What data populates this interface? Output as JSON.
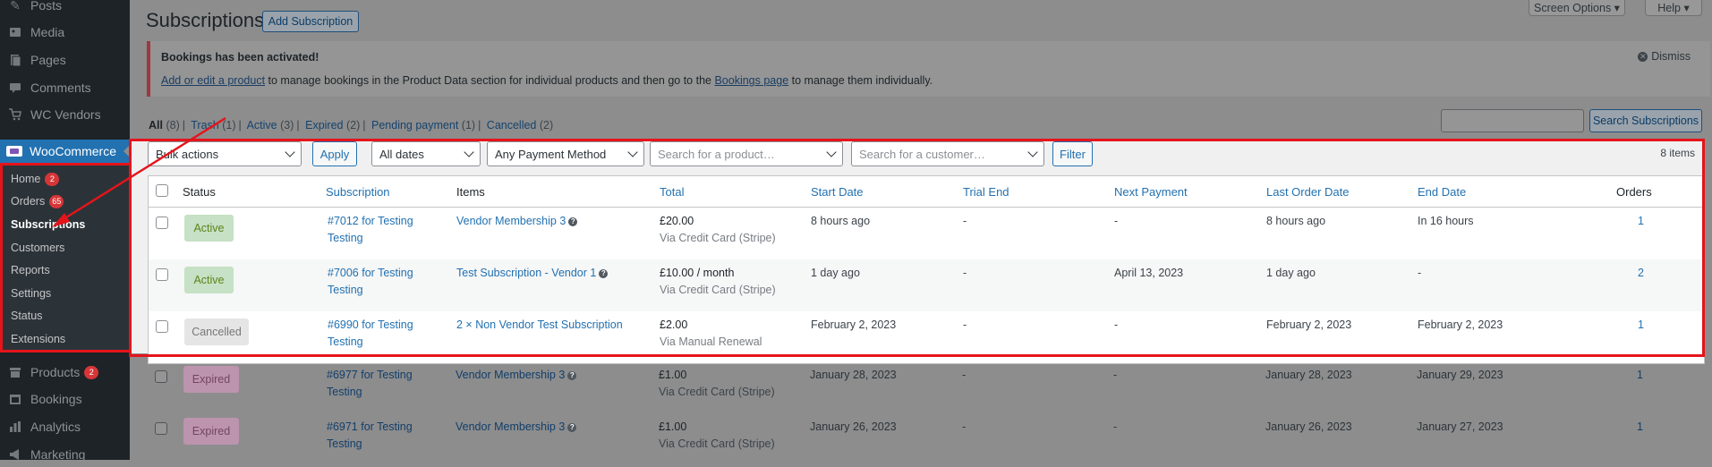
{
  "sidebar": {
    "items_top": [
      {
        "label": "Posts",
        "icon": "pin-icon"
      },
      {
        "label": "Media",
        "icon": "media-icon"
      },
      {
        "label": "Pages",
        "icon": "pages-icon"
      },
      {
        "label": "Comments",
        "icon": "comment-icon"
      },
      {
        "label": "WC Vendors",
        "icon": "cart-icon"
      }
    ],
    "woocommerce": {
      "label": "WooCommerce",
      "icon": "woocommerce-icon"
    },
    "submenu": [
      {
        "label": "Home",
        "badge": "2"
      },
      {
        "label": "Orders",
        "badge": "65"
      },
      {
        "label": "Subscriptions"
      },
      {
        "label": "Customers"
      },
      {
        "label": "Reports"
      },
      {
        "label": "Settings"
      },
      {
        "label": "Status"
      },
      {
        "label": "Extensions"
      }
    ],
    "items_bottom": [
      {
        "label": "Products",
        "badge": "2",
        "icon": "archive-icon"
      },
      {
        "label": "Bookings",
        "icon": "calendar-icon"
      },
      {
        "label": "Analytics",
        "icon": "bar-chart-icon"
      },
      {
        "label": "Marketing",
        "icon": "megaphone-icon"
      }
    ]
  },
  "header": {
    "title": "Subscriptions",
    "add_button": "Add Subscription",
    "screen_options": "Screen Options ▾",
    "help": "Help ▾"
  },
  "notice": {
    "title": "Bookings has been activated!",
    "link1": "Add or edit a product",
    "text1": " to manage bookings in the Product Data section for individual products and then go to the ",
    "link2": "Bookings page",
    "text2": " to manage them individually.",
    "dismiss": "Dismiss"
  },
  "filters": [
    {
      "label": "All",
      "count": "(8)"
    },
    {
      "label": "Trash",
      "count": "(1)"
    },
    {
      "label": "Active",
      "count": "(3)"
    },
    {
      "label": "Expired",
      "count": "(2)"
    },
    {
      "label": "Pending payment",
      "count": "(1)"
    },
    {
      "label": "Cancelled",
      "count": "(2)"
    }
  ],
  "search_button": "Search Subscriptions",
  "toolbar": {
    "bulk_actions": "Bulk actions",
    "apply": "Apply",
    "dates": "All dates",
    "payment_method": "Any Payment Method",
    "product_placeholder": "Search for a product…",
    "customer_placeholder": "Search for a customer…",
    "filter": "Filter",
    "items_count": "8 items"
  },
  "table": {
    "headers": [
      "Status",
      "Subscription",
      "Items",
      "Total",
      "Start Date",
      "Trial End",
      "Next Payment",
      "Last Order Date",
      "End Date",
      "Orders"
    ],
    "rows": [
      {
        "status": "Active",
        "sub_id": "#7012",
        "for": "for",
        "customer_l1": "Testing",
        "customer_l2": "Testing",
        "item": "Vendor Membership 3",
        "total": "£20.00",
        "via": "Via Credit Card (Stripe)",
        "start": "8 hours ago",
        "trial_end": "-",
        "next_payment": "-",
        "last_order": "8 hours ago",
        "end": "In 16 hours",
        "orders": "1"
      },
      {
        "status": "Active",
        "sub_id": "#7006",
        "for": "for",
        "customer_l1": "Testing",
        "customer_l2": "Testing",
        "item": "Test Subscription - Vendor 1",
        "total": "£10.00 / month",
        "via": "Via Credit Card (Stripe)",
        "start": "1 day ago",
        "trial_end": "-",
        "next_payment": "April 13, 2023",
        "last_order": "1 day ago",
        "end": "-",
        "orders": "2"
      },
      {
        "status": "Cancelled",
        "sub_id": "#6990",
        "for": "for",
        "customer_l1": "Testing",
        "customer_l2": "Testing",
        "item": "2 × Non Vendor Test Subscription",
        "total": "£2.00",
        "via": "Via Manual Renewal",
        "start": "February 2, 2023",
        "trial_end": "-",
        "next_payment": "-",
        "last_order": "February 2, 2023",
        "end": "February 2, 2023",
        "orders": "1"
      },
      {
        "status": "Expired",
        "sub_id": "#6977",
        "for": "for",
        "customer_l1": "Testing",
        "customer_l2": "Testing",
        "item": "Vendor Membership 3",
        "total": "£1.00",
        "via": "Via Credit Card (Stripe)",
        "start": "January 28, 2023",
        "trial_end": "-",
        "next_payment": "-",
        "last_order": "January 28, 2023",
        "end": "January 29, 2023",
        "orders": "1"
      },
      {
        "status": "Expired",
        "sub_id": "#6971",
        "for": "for",
        "customer_l1": "Testing",
        "customer_l2": "Testing",
        "item": "Vendor Membership 3",
        "total": "£1.00",
        "via": "Via Credit Card (Stripe)",
        "start": "January 26, 2023",
        "trial_end": "-",
        "next_payment": "-",
        "last_order": "January 26, 2023",
        "end": "January 27, 2023",
        "orders": "1"
      }
    ]
  },
  "colors": {
    "highlight": "#e5141b",
    "accent": "#2271b1",
    "sidebar": "#1d2327"
  }
}
